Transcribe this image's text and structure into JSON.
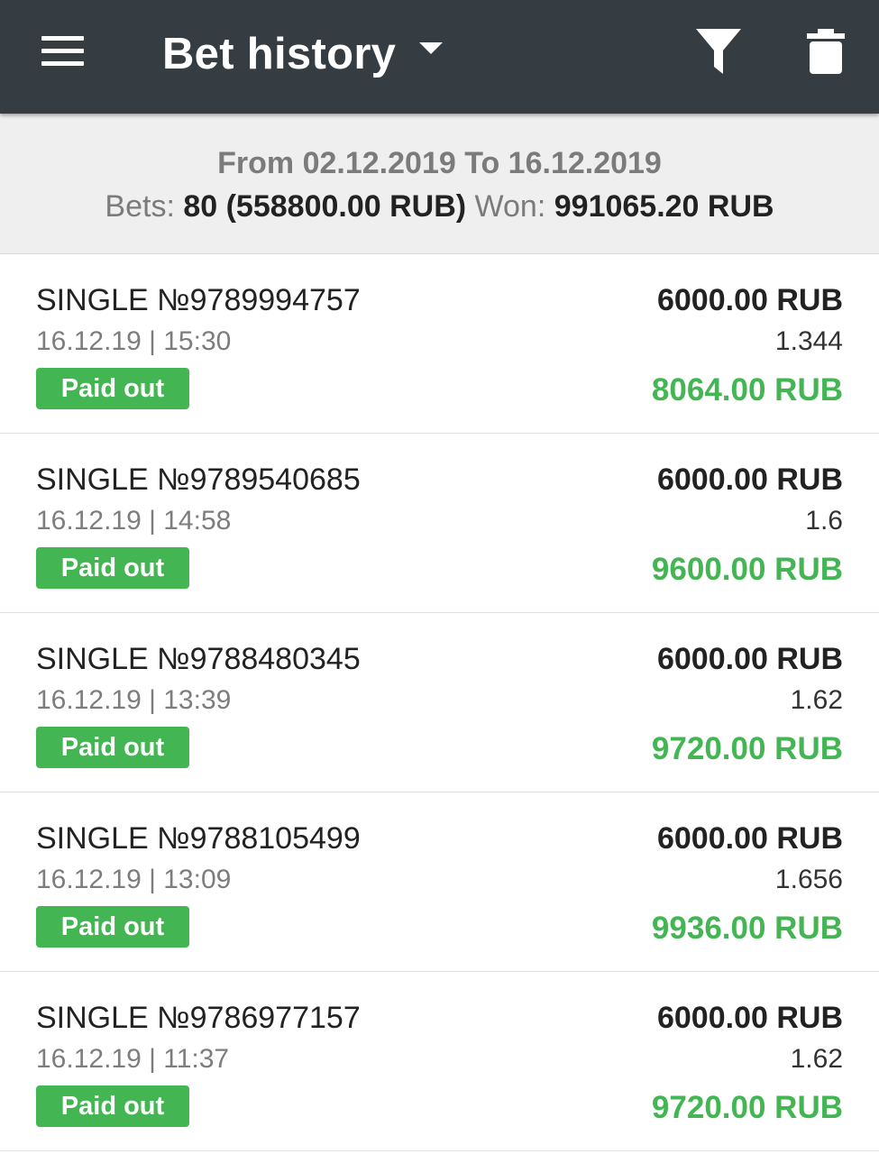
{
  "header": {
    "title": "Bet history",
    "menu_icon": "hamburger-menu-icon",
    "dropdown_icon": "caret-down-icon",
    "filter_icon": "filter-icon",
    "delete_icon": "trash-icon",
    "background_color": "#353c42"
  },
  "summary": {
    "range_text": "From 02.12.2019 To 16.12.2019",
    "bets_label": "Bets:",
    "bets_value": "80 (558800.00 RUB)",
    "won_label": "Won:",
    "won_value": "991065.20 RUB"
  },
  "colors": {
    "accent_green": "#43b653",
    "text_dark": "#222222",
    "text_muted": "#7d7d7d"
  },
  "bets": [
    {
      "title": "SINGLE №9789994757",
      "datetime": "16.12.19 | 15:30",
      "status": "Paid out",
      "stake": "6000.00 RUB",
      "odds": "1.344",
      "win": "8064.00 RUB"
    },
    {
      "title": "SINGLE №9789540685",
      "datetime": "16.12.19 | 14:58",
      "status": "Paid out",
      "stake": "6000.00 RUB",
      "odds": "1.6",
      "win": "9600.00 RUB"
    },
    {
      "title": "SINGLE №9788480345",
      "datetime": "16.12.19 | 13:39",
      "status": "Paid out",
      "stake": "6000.00 RUB",
      "odds": "1.62",
      "win": "9720.00 RUB"
    },
    {
      "title": "SINGLE №9788105499",
      "datetime": "16.12.19 | 13:09",
      "status": "Paid out",
      "stake": "6000.00 RUB",
      "odds": "1.656",
      "win": "9936.00 RUB"
    },
    {
      "title": "SINGLE №9786977157",
      "datetime": "16.12.19 | 11:37",
      "status": "Paid out",
      "stake": "6000.00 RUB",
      "odds": "1.62",
      "win": "9720.00 RUB"
    }
  ]
}
